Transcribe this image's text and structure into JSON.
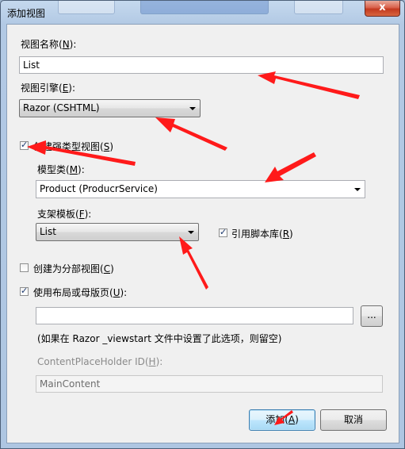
{
  "window": {
    "title": "添加视图",
    "close_label": "x"
  },
  "view_name": {
    "label": "视图名称(",
    "key": "N",
    "suffix": "):",
    "value": "List"
  },
  "view_engine": {
    "label": "视图引擎(",
    "key": "E",
    "suffix": "):",
    "selected": "Razor (CSHTML)"
  },
  "strong_type": {
    "label": "创建强类型视图(",
    "key": "S",
    "suffix": ")",
    "checked": true,
    "check_glyph": "✓"
  },
  "model_class": {
    "label": "模型类(",
    "key": "M",
    "suffix": "):",
    "selected": "Product (ProducrService)"
  },
  "scaffold": {
    "label": "支架模板(",
    "key": "F",
    "suffix": "):",
    "selected": "List"
  },
  "script_libs": {
    "label": "引用脚本库(",
    "key": "R",
    "suffix": ")",
    "checked": true,
    "check_glyph": "✓"
  },
  "partial_view": {
    "label": "创建为分部视图(",
    "key": "C",
    "suffix": ")",
    "checked": false
  },
  "layout_page": {
    "label": "使用布局或母版页(",
    "key": "U",
    "suffix": "):",
    "checked": true,
    "check_glyph": "✓",
    "value": "",
    "browse_label": "..."
  },
  "layout_hint": "(如果在 Razor _viewstart 文件中设置了此选项，则留空)",
  "placeholder_id": {
    "label": "ContentPlaceHolder ID(",
    "key": "H",
    "suffix": "):",
    "value": "MainContent"
  },
  "buttons": {
    "add": {
      "label": "添加(",
      "key": "A",
      "suffix": ")"
    },
    "cancel": {
      "label": "取消"
    }
  },
  "colors": {
    "annotation_arrow": "#ff1a1a",
    "title_bar": "#b2c9e4",
    "close_button": "#c3391f"
  }
}
